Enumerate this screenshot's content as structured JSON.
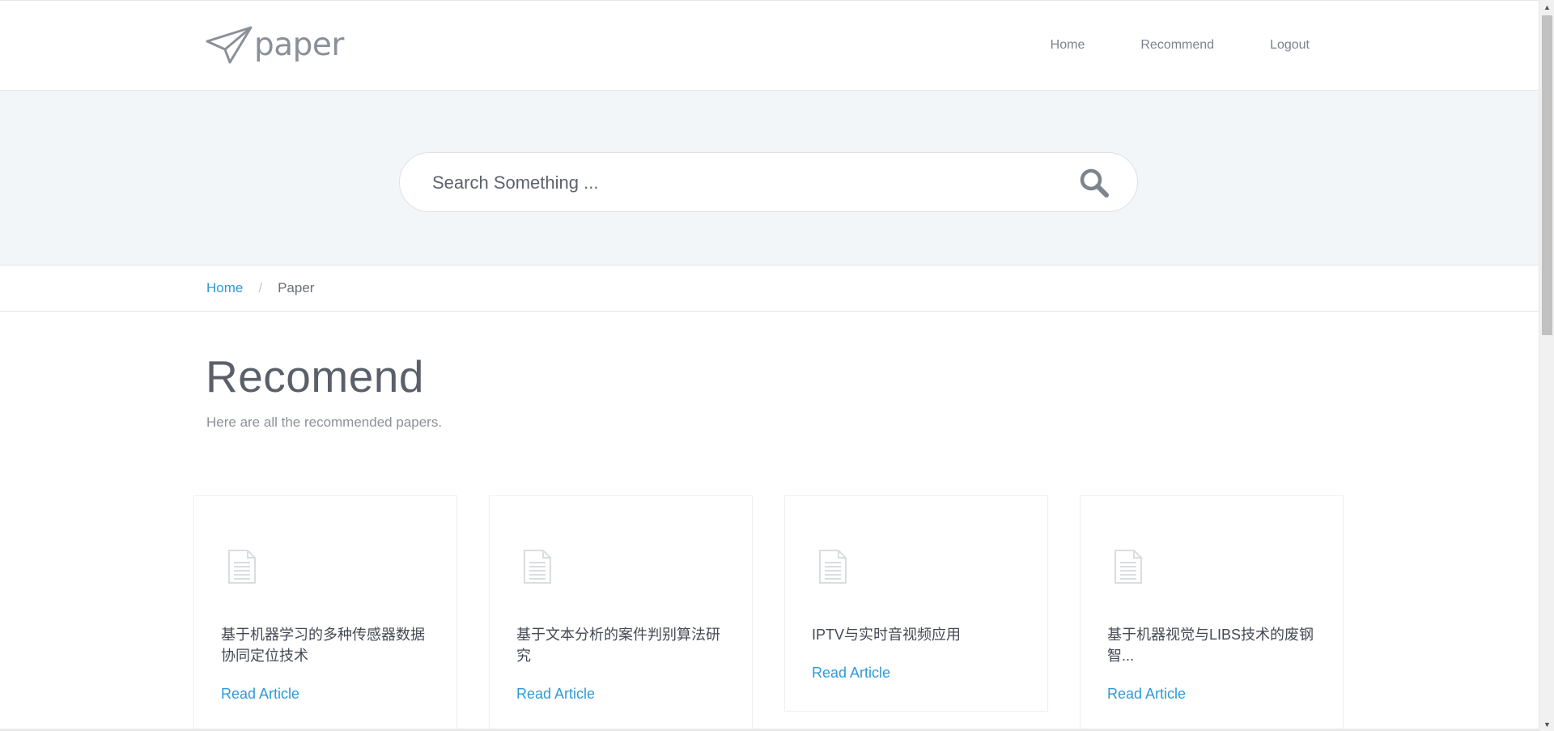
{
  "header": {
    "logo_text": "paper",
    "nav": [
      {
        "label": "Home"
      },
      {
        "label": "Recommend"
      },
      {
        "label": "Logout"
      }
    ]
  },
  "search": {
    "placeholder": "Search Something ...",
    "value": ""
  },
  "breadcrumb": {
    "home": "Home",
    "separator": "/",
    "current": "Paper"
  },
  "section": {
    "title": "Recomend",
    "subtitle": "Here are all the recommended papers."
  },
  "cards": [
    {
      "title": "基于机器学习的多种传感器数据协同定位技术",
      "link": "Read Article"
    },
    {
      "title": "基于文本分析的案件判别算法研究",
      "link": "Read Article"
    },
    {
      "title": "IPTV与实时音视频应用",
      "link": "Read Article"
    },
    {
      "title": "基于机器视觉与LIBS技术的废钢智...",
      "link": "Read Article"
    }
  ],
  "colors": {
    "accent": "#2e9ad9",
    "band": "#f3f6f8",
    "text": "#555b66"
  },
  "icons": {
    "logo": "paper-plane-icon",
    "search": "search-icon",
    "card": "document-icon"
  }
}
